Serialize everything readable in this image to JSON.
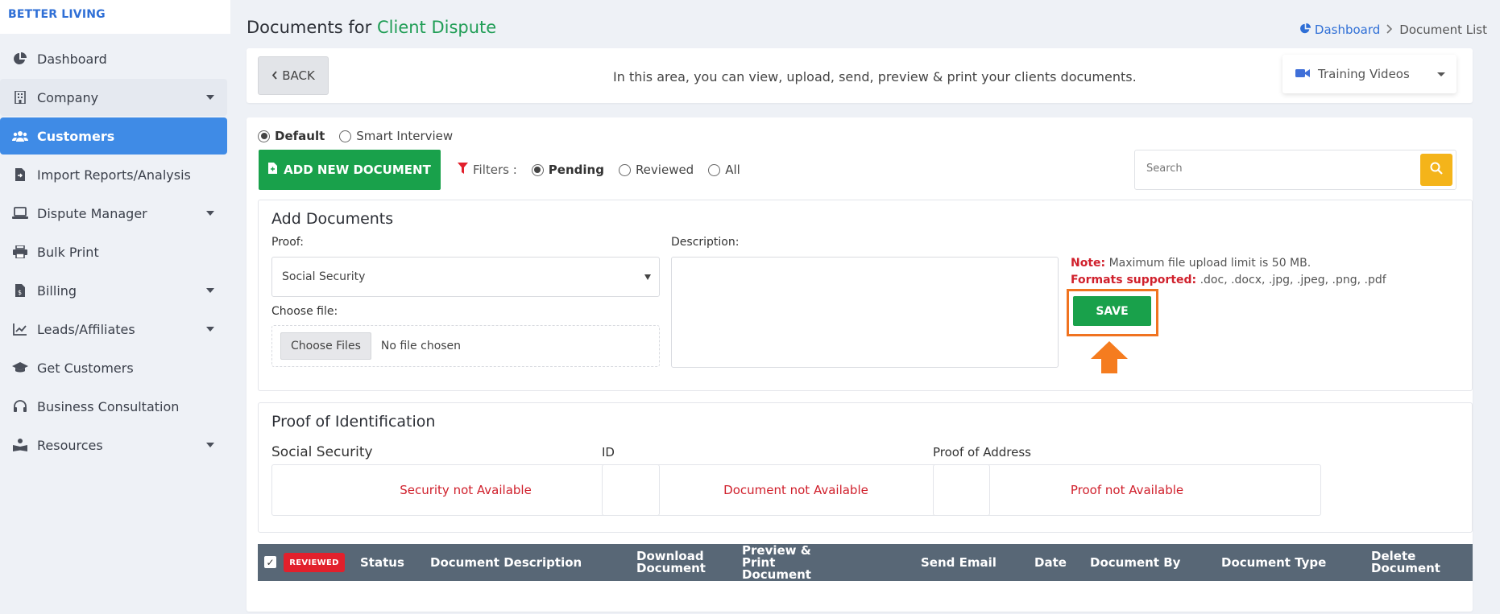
{
  "brand": "BETTER LIVING",
  "sidebar": {
    "items": [
      {
        "label": "Dashboard",
        "icon": "pie-chart-icon",
        "has_caret": false
      },
      {
        "label": "Company",
        "icon": "building-icon",
        "has_caret": true
      },
      {
        "label": "Customers",
        "icon": "users-icon",
        "has_caret": false,
        "active": true
      },
      {
        "label": "Import Reports/Analysis",
        "icon": "file-import-icon",
        "has_caret": false
      },
      {
        "label": "Dispute Manager",
        "icon": "laptop-icon",
        "has_caret": true
      },
      {
        "label": "Bulk Print",
        "icon": "printer-icon",
        "has_caret": false
      },
      {
        "label": "Billing",
        "icon": "invoice-icon",
        "has_caret": true
      },
      {
        "label": "Leads/Affiliates",
        "icon": "line-chart-icon",
        "has_caret": true
      },
      {
        "label": "Get Customers",
        "icon": "graduation-cap-icon",
        "has_caret": false
      },
      {
        "label": "Business Consultation",
        "icon": "headset-icon",
        "has_caret": false
      },
      {
        "label": "Resources",
        "icon": "book-reader-icon",
        "has_caret": true
      }
    ]
  },
  "header": {
    "title_prefix": "Documents for",
    "title_highlight": "Client Dispute",
    "breadcrumb": {
      "home": "Dashboard",
      "current": "Document List"
    }
  },
  "top_bar": {
    "back_label": "BACK",
    "info": "In this area, you can view, upload, send, preview & print your clients documents.",
    "training_label": "Training Videos"
  },
  "modes": {
    "default_label": "Default",
    "smart_label": "Smart Interview",
    "selected": "Default"
  },
  "toolbar": {
    "add_label": "ADD NEW DOCUMENT",
    "filters_label": "Filters :",
    "filter_options": [
      "Pending",
      "Reviewed",
      "All"
    ],
    "filter_selected": "Pending",
    "search_placeholder": "Search"
  },
  "add_documents": {
    "title": "Add Documents",
    "proof_label": "Proof:",
    "proof_value": "Social Security",
    "file_label": "Choose file:",
    "file_button": "Choose Files",
    "file_status": "No file chosen",
    "description_label": "Description:",
    "note_label": "Note:",
    "note_text": "Maximum file upload limit is 50 MB.",
    "formats_label": "Formats supported:",
    "formats_text": ".doc, .docx, .jpg, .jpeg, .png, .pdf",
    "save_label": "SAVE"
  },
  "proof_identification": {
    "title": "Proof of Identification",
    "columns": [
      {
        "label": "Social Security",
        "status": "Security not Available"
      },
      {
        "label": "ID",
        "status": "Document not Available"
      },
      {
        "label": "Proof of Address",
        "status": "Proof not Available"
      }
    ]
  },
  "table": {
    "badge": "REVIEWED",
    "headers": [
      "Status",
      "Document Description",
      "Download Document",
      "Preview & Print Document",
      "Send Email",
      "Date",
      "Document By",
      "Document Type",
      "Delete Document"
    ]
  },
  "colors": {
    "accent_green": "#19a14b",
    "active_blue": "#3f8be6",
    "alert_red": "#d0202c",
    "highlight_orange": "#f07320",
    "search_yellow": "#f4b41a"
  }
}
